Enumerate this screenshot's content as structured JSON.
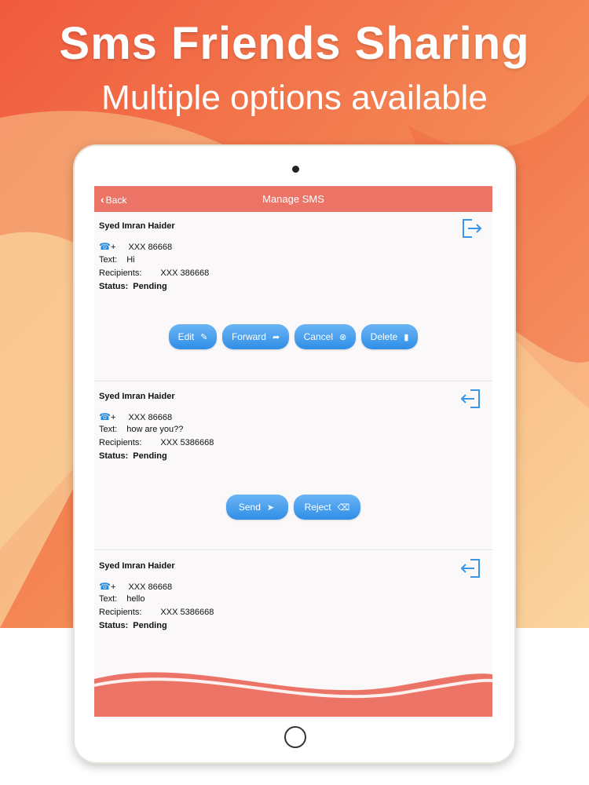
{
  "promo": {
    "title": "Sms Friends Sharing",
    "subtitle": "Multiple options available"
  },
  "colors": {
    "accent": "#ec7466",
    "button": "#3a94e8",
    "background_top": "#ef6a4c",
    "background_bottom": "#fbd9a8"
  },
  "navbar": {
    "back_label": "Back",
    "title": "Manage SMS"
  },
  "labels": {
    "text": "Text:",
    "recipients": "Recipients:",
    "status": "Status:",
    "phone_prefix": "+"
  },
  "messages": [
    {
      "name": "Syed Imran Haider",
      "phone": "XXX 86668",
      "text": "Hi",
      "recipients": "XXX 386668",
      "status": "Pending",
      "icon": "logout-icon",
      "actions": [
        {
          "label": "Edit",
          "icon": "pencil-icon"
        },
        {
          "label": "Forward",
          "icon": "share-icon"
        },
        {
          "label": "Cancel",
          "icon": "close-circle-icon"
        },
        {
          "label": "Delete",
          "icon": "trash-icon"
        }
      ]
    },
    {
      "name": "Syed Imran Haider",
      "phone": "XXX 86668",
      "text": "how are you??",
      "recipients": "XXX 5386668",
      "status": "Pending",
      "icon": "login-icon",
      "actions": [
        {
          "label": "Send",
          "icon": "paper-plane-icon"
        },
        {
          "label": "Reject",
          "icon": "backspace-icon"
        }
      ]
    },
    {
      "name": "Syed Imran Haider",
      "phone": "XXX 86668",
      "text": "hello",
      "recipients": "XXX 5386668",
      "status": "Pending",
      "icon": "login-icon"
    }
  ]
}
